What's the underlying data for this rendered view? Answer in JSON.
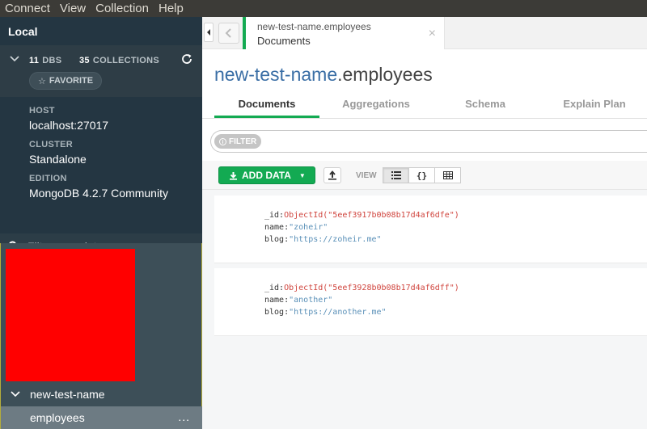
{
  "menubar": {
    "items": [
      "Connect",
      "View",
      "Collection",
      "Help"
    ]
  },
  "sidebar": {
    "title": "Local",
    "dbs_count": "11",
    "dbs_label": "DBS",
    "collections_count": "35",
    "collections_label": "COLLECTIONS",
    "favorite_label": "FAVORITE",
    "host_label": "HOST",
    "host_value": "localhost:27017",
    "cluster_label": "CLUSTER",
    "cluster_value": "Standalone",
    "edition_label": "EDITION",
    "edition_value": "MongoDB 4.2.7 Community",
    "filter_placeholder": "Filter your data",
    "tree": {
      "db_name": "new-test-name",
      "collection_name": "employees",
      "collection_menu": "..."
    }
  },
  "tab": {
    "namespace": "new-test-name.employees",
    "type": "Documents",
    "close": "×"
  },
  "main": {
    "title_db": "new-test-name",
    "title_coll": ".employees",
    "subtabs": [
      "Documents",
      "Aggregations",
      "Schema",
      "Explain Plan"
    ],
    "filter_label": "FILTER",
    "add_data_label": "ADD DATA",
    "view_label": "VIEW"
  },
  "documents": [
    {
      "id_key": "_id:",
      "id_value": "ObjectId(\"5eef3917b0b08b17d4af6dfe\")",
      "name_key": "name:",
      "name_value": "\"zoheir\"",
      "blog_key": "blog:",
      "blog_value": "\"https://zoheir.me\""
    },
    {
      "id_key": "_id:",
      "id_value": "ObjectId(\"5eef3928b0b08b17d4af6dff\")",
      "name_key": "name:",
      "name_value": "\"another\"",
      "blog_key": "blog:",
      "blog_value": "\"https://another.me\""
    }
  ],
  "colors": {
    "accent": "#13aa52",
    "sidebar": "#3d4f58",
    "sidebar_dark": "#243642",
    "redacted": "#ff0000"
  }
}
